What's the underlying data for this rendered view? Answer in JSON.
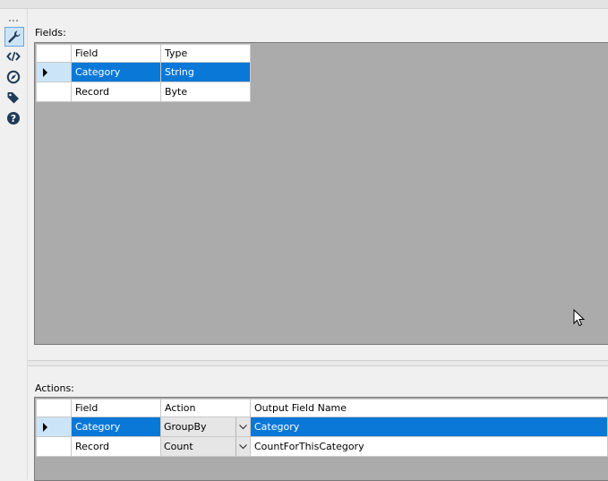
{
  "fields_panel": {
    "label": "Fields:",
    "columns": [
      "Field",
      "Type"
    ],
    "rows": [
      {
        "field": "Category",
        "type": "String",
        "selected": true
      },
      {
        "field": "Record",
        "type": "Byte",
        "selected": false
      }
    ]
  },
  "actions_panel": {
    "label": "Actions:",
    "columns": [
      "Field",
      "Action",
      "Output Field Name"
    ],
    "rows": [
      {
        "field": "Category",
        "action": "GroupBy",
        "output": "Category",
        "selected": true
      },
      {
        "field": "Record",
        "action": "Count",
        "output": "CountForThisCategory",
        "selected": false
      }
    ]
  },
  "toolbar": {
    "items": [
      "wrench-icon",
      "code-icon",
      "compass-icon",
      "tag-icon",
      "help-icon"
    ]
  },
  "colors": {
    "selection": "#0a78d7",
    "grid_background": "#ababab",
    "row_header_selected": "#cce4f7"
  }
}
